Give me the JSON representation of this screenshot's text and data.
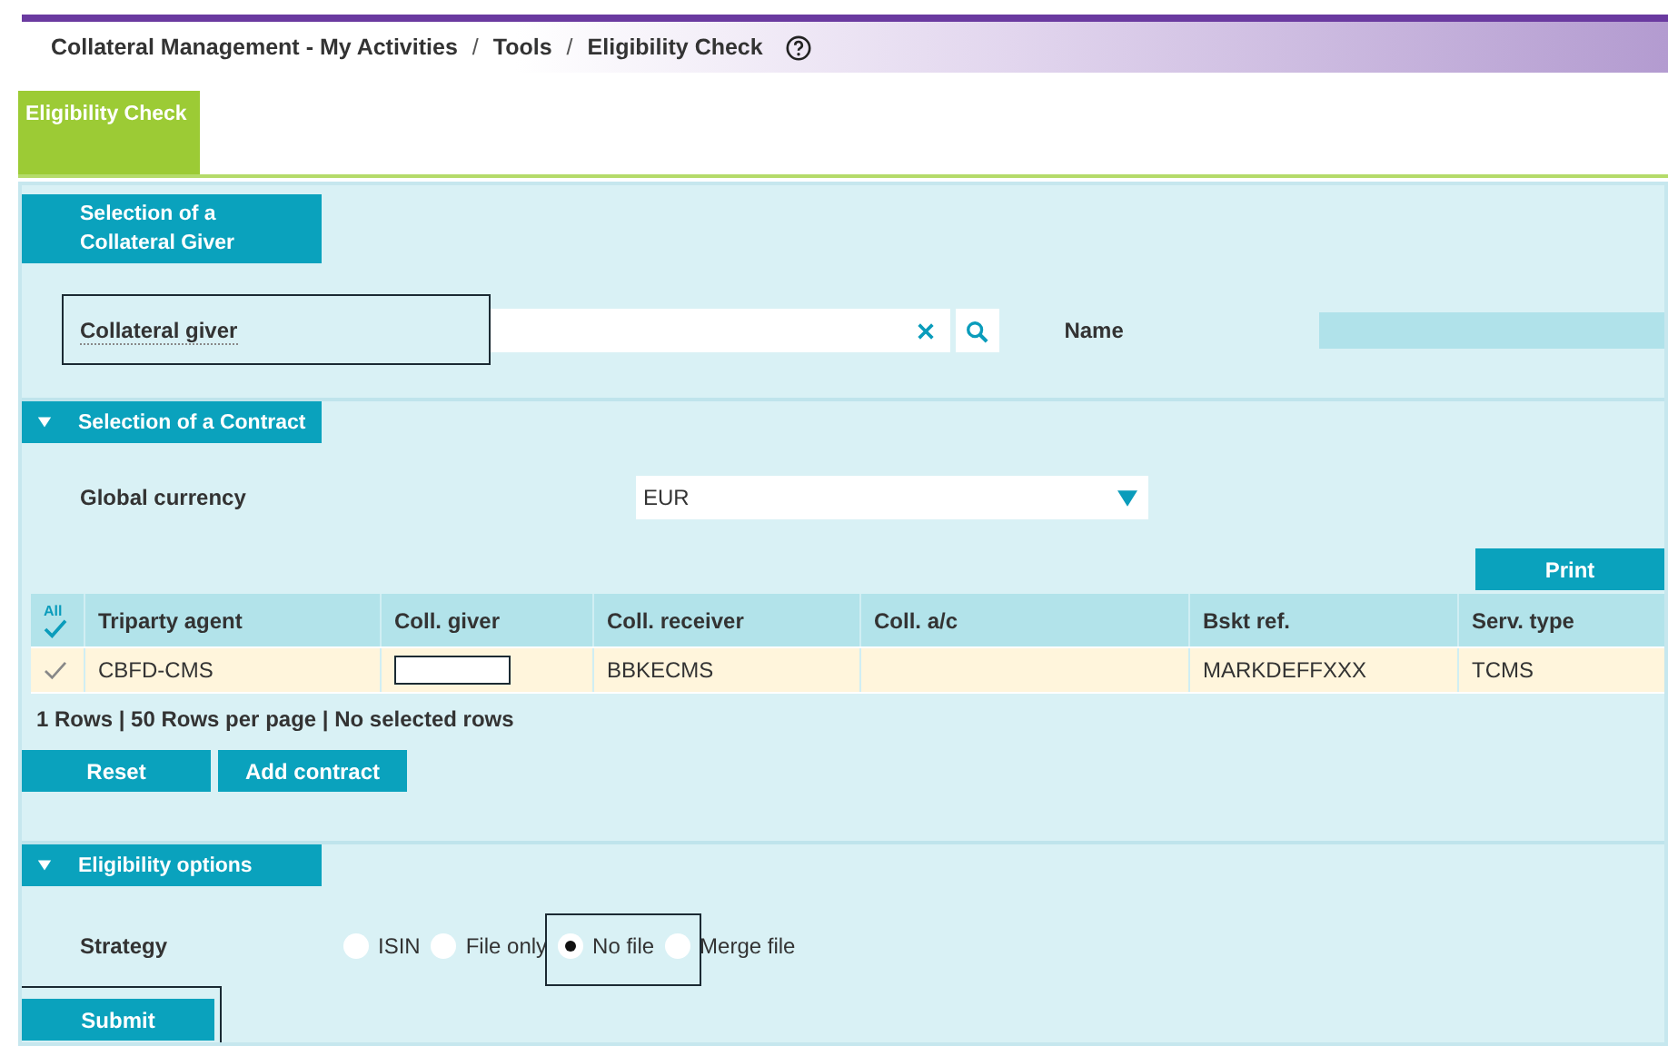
{
  "breadcrumb": [
    {
      "kind": "link",
      "text": "Collateral Management - My Activities"
    },
    {
      "kind": "separator",
      "text": "/"
    },
    {
      "kind": "link",
      "text": "Tools"
    },
    {
      "kind": "separator",
      "text": "/"
    },
    {
      "kind": "link",
      "text": "Eligibility Check"
    }
  ],
  "tabs": [
    {
      "label": "Eligibility Check",
      "selected": true
    }
  ],
  "giver_section": {
    "title": "Selection of a Collateral Giver",
    "giver_field": {
      "label": "Collateral giver",
      "highlighted": true
    },
    "name_field": {
      "label": "Name"
    }
  },
  "contract_section": {
    "title": "Selection of a Contract",
    "expanded": true,
    "currency": {
      "label": "Global currency",
      "value": "EUR"
    },
    "print_button": "Print",
    "table": {
      "select_all": "All",
      "columns": [
        "Triparty agent",
        "Coll. giver",
        "Coll. receiver",
        "Coll. a/c",
        "Bskt ref.",
        "Serv. type"
      ],
      "rows": [
        {
          "selected": false,
          "cells": [
            {
              "text": "CBFD-CMS"
            },
            {
              "boxed": true
            },
            {
              "text": "BBKECMS"
            },
            {},
            {
              "text": "MARKDEFFXXX"
            },
            {
              "text": "TCMS"
            }
          ]
        }
      ]
    },
    "footer": "1 Rows | 50 Rows per page | No selected rows",
    "buttons": [
      "Reset",
      "Add contract"
    ]
  },
  "options_section": {
    "title": "Eligibility options",
    "expanded": true,
    "strategy": {
      "label": "Strategy",
      "options": [
        {
          "label": "ISIN",
          "selected": false,
          "highlighted": false
        },
        {
          "label": "File only",
          "selected": false,
          "highlighted": false
        },
        {
          "label": "No file",
          "selected": true,
          "highlighted": true
        },
        {
          "label": "Merge file",
          "selected": false,
          "highlighted": false
        }
      ]
    }
  },
  "submit": {
    "label": "Submit",
    "highlighted": true
  }
}
